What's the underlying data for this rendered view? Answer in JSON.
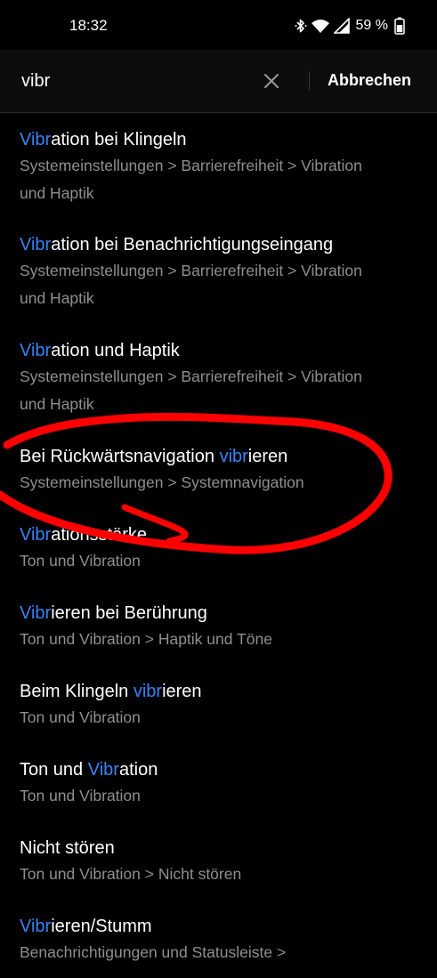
{
  "status_bar": {
    "time": "18:32",
    "battery": "59 %",
    "icons": [
      "bluetooth-icon",
      "wifi-icon",
      "signal-icon",
      "battery-icon"
    ]
  },
  "search": {
    "query": "vibr",
    "cancel_label": "Abbrechen"
  },
  "colors": {
    "highlight": "#3b82f6",
    "annotation": "#ff0000",
    "subtitle": "#8f8f8f"
  },
  "results": [
    {
      "title_pre": "",
      "title_hl": "Vibr",
      "title_post": "ation bei Klingeln",
      "sub": [
        "Systemeinstellungen > Barrierefreiheit > Vibration",
        "und Haptik"
      ]
    },
    {
      "title_pre": "",
      "title_hl": "Vibr",
      "title_post": "ation bei Benachrichtigungseingang",
      "sub": [
        "Systemeinstellungen > Barrierefreiheit > Vibration",
        "und Haptik"
      ]
    },
    {
      "title_pre": "",
      "title_hl": "Vibr",
      "title_post": "ation und Haptik",
      "sub": [
        "Systemeinstellungen > Barrierefreiheit > Vibration",
        "und Haptik"
      ]
    },
    {
      "title_pre": "Bei Rückwärtsnavigation ",
      "title_hl": "vibr",
      "title_post": "ieren",
      "sub": [
        "Systemeinstellungen > Systemnavigation"
      ]
    },
    {
      "title_pre": "",
      "title_hl": "Vibr",
      "title_post": "ationsstärke",
      "sub": [
        "Ton und Vibration"
      ]
    },
    {
      "title_pre": "",
      "title_hl": "Vibr",
      "title_post": "ieren bei Berührung",
      "sub": [
        "Ton und Vibration > Haptik und Töne"
      ]
    },
    {
      "title_pre": "Beim Klingeln ",
      "title_hl": "vibr",
      "title_post": "ieren",
      "sub": [
        "Ton und Vibration"
      ]
    },
    {
      "title_pre": "Ton und ",
      "title_hl": "Vibr",
      "title_post": "ation",
      "sub": [
        "Ton und Vibration"
      ]
    },
    {
      "title_pre": "Nicht stören",
      "title_hl": "",
      "title_post": "",
      "sub": [
        "Ton und Vibration > Nicht stören"
      ]
    },
    {
      "title_pre": "",
      "title_hl": "Vibr",
      "title_post": "ieren/Stumm",
      "sub": [
        "Benachrichtigungen und Statusleiste >"
      ]
    }
  ]
}
